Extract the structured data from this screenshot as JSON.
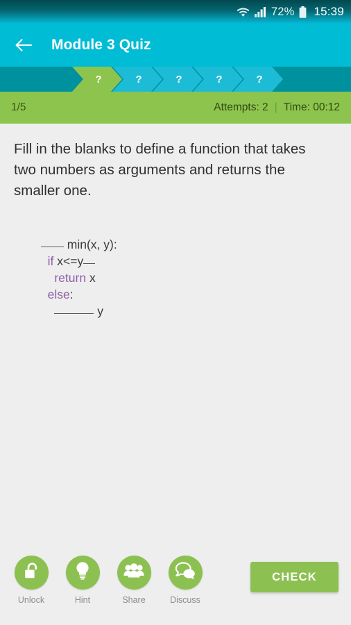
{
  "status_bar": {
    "wifi_icon": "wifi-icon",
    "signal_icon": "signal-bars-icon",
    "battery_percent": "72%",
    "battery_icon": "battery-icon",
    "time": "15:39"
  },
  "app_bar": {
    "back_icon": "back-arrow-icon",
    "title": "Module 3 Quiz",
    "background_color": "#00bcd4"
  },
  "progress": {
    "background_color": "#00919f",
    "active_color": "#8dc44e",
    "inactive_color": "#1dbcd6",
    "steps": [
      {
        "label": "?",
        "state": "active"
      },
      {
        "label": "?",
        "state": "inactive"
      },
      {
        "label": "?",
        "state": "inactive"
      },
      {
        "label": "?",
        "state": "inactive"
      },
      {
        "label": "?",
        "state": "inactive"
      }
    ]
  },
  "meta_bar": {
    "background_color": "#8dc44e",
    "position": "1/5",
    "attempts": "Attempts: 2",
    "separator": "|",
    "time": "Time: 00:12"
  },
  "question": {
    "prompt": "Fill in the blanks to define a function that takes two numbers as arguments and returns the smaller one.",
    "code": {
      "line1": {
        "blank": "___",
        "text": " min(x, y):"
      },
      "line2": {
        "keyword": "if",
        "text": " x<=y",
        "blank": "__"
      },
      "line3": {
        "keyword": "return",
        "text": " x"
      },
      "line4": {
        "keyword": "else",
        "text": ":"
      },
      "line5": {
        "blank": "______",
        "text": " y"
      }
    }
  },
  "tools": [
    {
      "label": "Unlock",
      "icon": "lock-icon"
    },
    {
      "label": "Hint",
      "icon": "lightbulb-icon"
    },
    {
      "label": "Share",
      "icon": "people-icon"
    },
    {
      "label": "Discuss",
      "icon": "speech-bubbles-icon"
    }
  ],
  "check_button": {
    "label": "CHECK",
    "color": "#8cc152"
  }
}
